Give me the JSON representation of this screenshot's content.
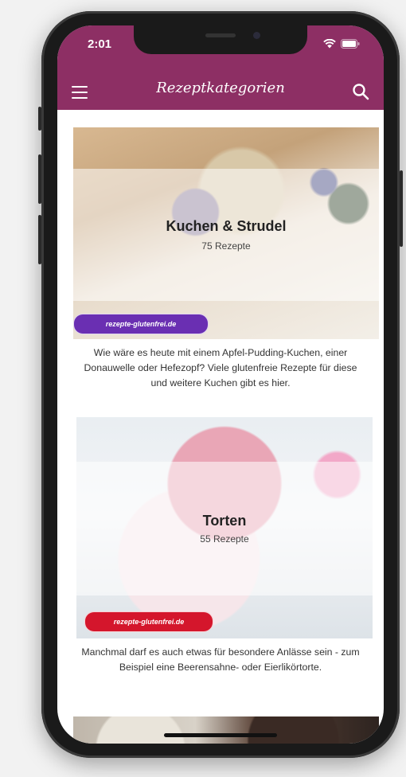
{
  "status_bar": {
    "time": "2:01",
    "icons": [
      "wifi-icon",
      "battery-icon"
    ]
  },
  "app_bar": {
    "title": "Rezeptkategorien",
    "left_icon": "hamburger-menu-icon",
    "right_icon": "search-icon",
    "color": "#8d2f64"
  },
  "categories": [
    {
      "title": "Kuchen & Strudel",
      "count": "75 Rezepte",
      "badge": "rezepte-glutenfrei.de",
      "badge_color": "#6a2fb2",
      "description": "Wie wäre es heute mit einem Apfel-Pudding-Kuchen, einer Donauwelle oder Hefezopf? Viele glutenfreie Rezepte für diese und weitere Kuchen gibt es hier."
    },
    {
      "title": "Torten",
      "count": "55 Rezepte",
      "badge": "rezepte-glutenfrei.de",
      "badge_color": "#d4162c",
      "description": "Manchmal darf es auch etwas für besondere Anlässe sein - zum Beispiel eine Beerensahne- oder Eierlikörtorte."
    }
  ]
}
